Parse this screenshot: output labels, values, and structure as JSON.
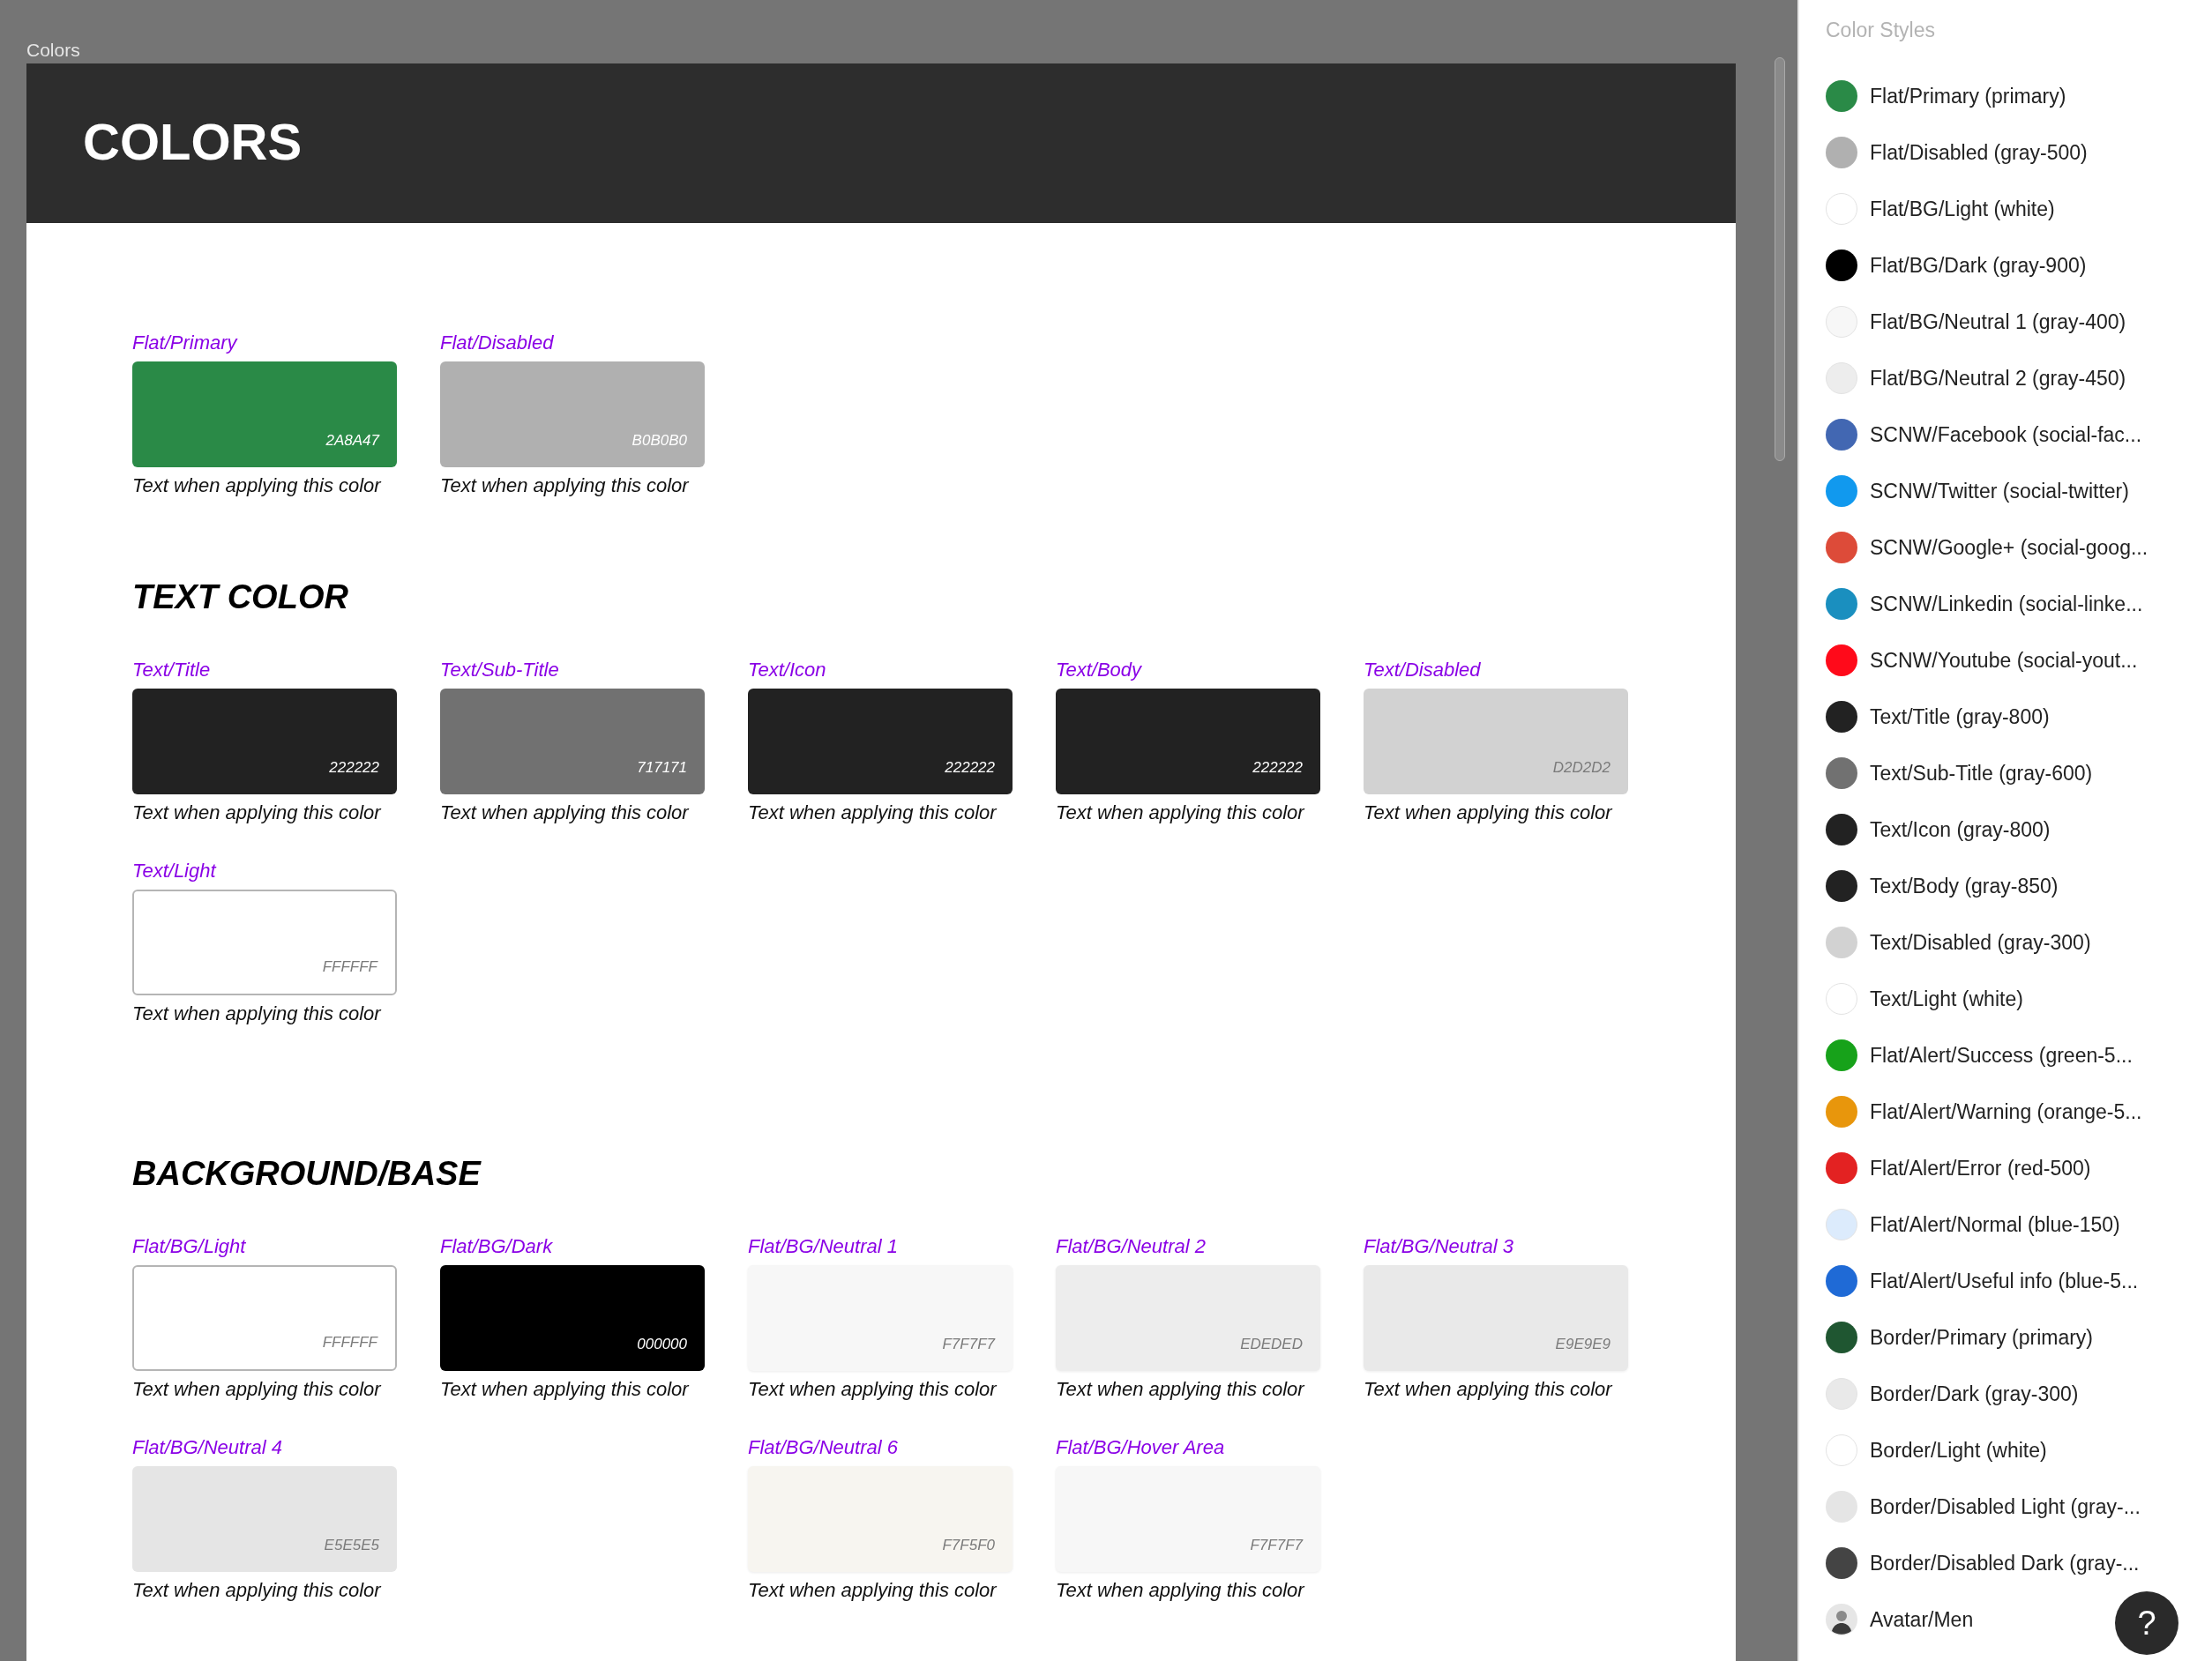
{
  "canvas_label": "Colors",
  "frame": {
    "title": "COLORS",
    "sections": [
      {
        "rows": [
          [
            {
              "kind": "swatch",
              "name": "Flat/Primary",
              "color": "#2a8a47",
              "hex": "2A8A47",
              "caption": "Text when applying this color"
            },
            {
              "kind": "swatch",
              "name": "Flat/Disabled",
              "color": "#b0b0b0",
              "hex": "B0B0B0",
              "caption": "Text when applying this color"
            }
          ]
        ]
      },
      {
        "heading": "TEXT COLOR",
        "rows": [
          [
            {
              "kind": "swatch",
              "name": "Text/Title",
              "color": "#222222",
              "hex": "222222",
              "caption": "Text when applying this color"
            },
            {
              "kind": "swatch",
              "name": "Text/Sub-Title",
              "color": "#717171",
              "hex": "717171",
              "caption": "Text when applying this color"
            },
            {
              "kind": "swatch",
              "name": "Text/Icon",
              "color": "#222222",
              "hex": "222222",
              "caption": "Text when applying this color"
            },
            {
              "kind": "swatch",
              "name": "Text/Body",
              "color": "#222222",
              "hex": "222222",
              "caption": "Text when applying this color"
            },
            {
              "kind": "swatch",
              "name": "Text/Disabled",
              "color": "#d2d2d2",
              "hex": "D2D2D2",
              "caption": "Text when applying this color"
            }
          ],
          [
            {
              "kind": "swatch",
              "name": "Text/Light",
              "color": "#ffffff",
              "hex": "FFFFFF",
              "caption": "Text when applying this color"
            }
          ]
        ]
      },
      {
        "heading": "BACKGROUND/BASE",
        "rows": [
          [
            {
              "kind": "swatch",
              "name": "Flat/BG/Light",
              "color": "#ffffff",
              "hex": "FFFFFF",
              "caption": "Text when applying this color"
            },
            {
              "kind": "swatch",
              "name": "Flat/BG/Dark",
              "color": "#000000",
              "hex": "000000",
              "caption": "Text when applying this color"
            },
            {
              "kind": "swatch",
              "name": "Flat/BG/Neutral 1",
              "color": "#f7f7f7",
              "hex": "F7F7F7",
              "caption": "Text when applying this color"
            },
            {
              "kind": "swatch",
              "name": "Flat/BG/Neutral 2",
              "color": "#ededed",
              "hex": "EDEDED",
              "caption": "Text when applying this color"
            },
            {
              "kind": "swatch",
              "name": "Flat/BG/Neutral 3",
              "color": "#e9e9e9",
              "hex": "E9E9E9",
              "caption": "Text when applying this color"
            }
          ],
          [
            {
              "kind": "swatch",
              "name": "Flat/BG/Neutral 4",
              "color": "#e5e5e5",
              "hex": "E5E5E5",
              "caption": "Text when applying this color"
            },
            {
              "kind": "blank"
            },
            {
              "kind": "swatch",
              "name": "Flat/BG/Neutral 6",
              "color": "#f7f5f0",
              "hex": "F7F5F0",
              "caption": "Text when applying this color"
            },
            {
              "kind": "swatch",
              "name": "Flat/BG/Hover Area",
              "color": "#f7f7f7",
              "hex": "F7F7F7",
              "caption": "Text when applying this color"
            }
          ]
        ]
      }
    ]
  },
  "sidebar": {
    "title": "Color Styles",
    "styles": [
      {
        "kind": "dot",
        "label": "Flat/Primary (primary)",
        "color": "#2a8a47"
      },
      {
        "kind": "dot",
        "label": "Flat/Disabled (gray-500)",
        "color": "#b0b0b0"
      },
      {
        "kind": "dot",
        "label": "Flat/BG/Light (white)",
        "color": "#ffffff"
      },
      {
        "kind": "dot",
        "label": "Flat/BG/Dark (gray-900)",
        "color": "#000000"
      },
      {
        "kind": "dot",
        "label": "Flat/BG/Neutral 1 (gray-400)",
        "color": "#f7f7f7"
      },
      {
        "kind": "dot",
        "label": "Flat/BG/Neutral 2 (gray-450)",
        "color": "#ededed"
      },
      {
        "kind": "dot",
        "label": "SCNW/Facebook (social-fac...",
        "color": "#4267b2"
      },
      {
        "kind": "dot",
        "label": "SCNW/Twitter (social-twitter)",
        "color": "#1199ee"
      },
      {
        "kind": "dot",
        "label": "SCNW/Google+ (social-goog...",
        "color": "#dd4b39"
      },
      {
        "kind": "dot",
        "label": "SCNW/Linkedin (social-linke...",
        "color": "#1a8fbf"
      },
      {
        "kind": "dot",
        "label": "SCNW/Youtube (social-yout...",
        "color": "#ff0a1a"
      },
      {
        "kind": "dot",
        "label": "Text/Title (gray-800)",
        "color": "#222222"
      },
      {
        "kind": "dot",
        "label": "Text/Sub-Title (gray-600)",
        "color": "#717171"
      },
      {
        "kind": "dot",
        "label": "Text/Icon (gray-800)",
        "color": "#222222"
      },
      {
        "kind": "dot",
        "label": "Text/Body (gray-850)",
        "color": "#222222"
      },
      {
        "kind": "dot",
        "label": "Text/Disabled (gray-300)",
        "color": "#d2d2d2"
      },
      {
        "kind": "dot",
        "label": "Text/Light (white)",
        "color": "#ffffff"
      },
      {
        "kind": "dot",
        "label": "Flat/Alert/Success (green-5...",
        "color": "#17a21a"
      },
      {
        "kind": "dot",
        "label": "Flat/Alert/Warning (orange-5...",
        "color": "#e8960c"
      },
      {
        "kind": "dot",
        "label": "Flat/Alert/Error (red-500)",
        "color": "#e32222"
      },
      {
        "kind": "dot",
        "label": "Flat/Alert/Normal (blue-150)",
        "color": "#dcebfc"
      },
      {
        "kind": "dot",
        "label": "Flat/Alert/Useful info (blue-5...",
        "color": "#1f6ad6"
      },
      {
        "kind": "dot",
        "label": "Border/Primary (primary)",
        "color": "#1f5631"
      },
      {
        "kind": "dot",
        "label": "Border/Dark (gray-300)",
        "color": "#e9e9e9"
      },
      {
        "kind": "dot",
        "label": "Border/Light (white)",
        "color": "#ffffff"
      },
      {
        "kind": "dot",
        "label": "Border/Disabled Light (gray-...",
        "color": "#e5e5e5"
      },
      {
        "kind": "dot",
        "label": "Border/Disabled Dark (gray-...",
        "color": "#444444"
      },
      {
        "kind": "avatar",
        "label": "Avatar/Men"
      }
    ]
  },
  "help_button": "?"
}
